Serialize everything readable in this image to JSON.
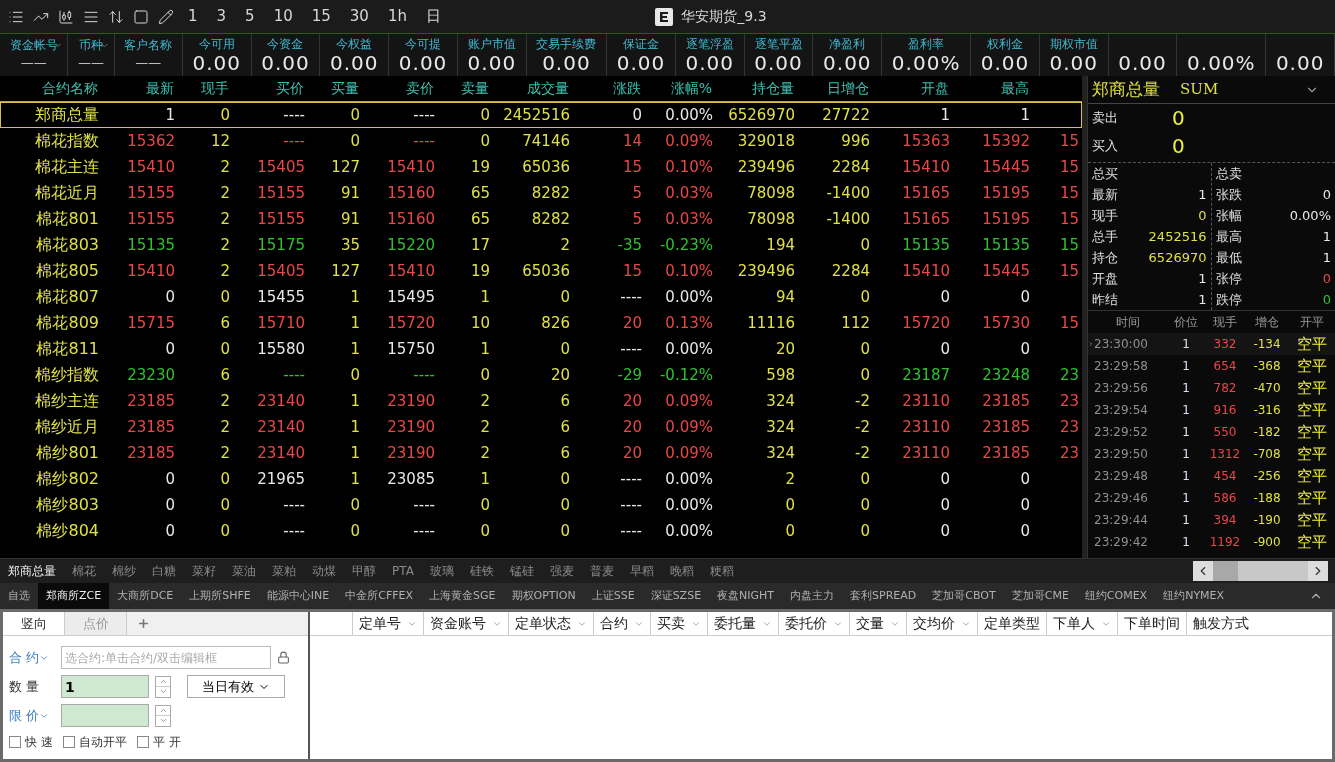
{
  "toolbar": {
    "periods": [
      "1",
      "3",
      "5",
      "10",
      "15",
      "30",
      "1h",
      "日"
    ],
    "title": "华安期货_9.3"
  },
  "account": [
    {
      "label": "资金帐号",
      "value": "——",
      "dropdown": true
    },
    {
      "label": "币种",
      "value": "——",
      "dropdown": true
    },
    {
      "label": "客户名称",
      "value": "——",
      "dropdown": false
    },
    {
      "label": "今可用",
      "value": "0.00",
      "dropdown": false
    },
    {
      "label": "今资金",
      "value": "0.00",
      "dropdown": false
    },
    {
      "label": "今权益",
      "value": "0.00",
      "dropdown": false
    },
    {
      "label": "今可提",
      "value": "0.00",
      "dropdown": false
    },
    {
      "label": "账户市值",
      "value": "0.00",
      "dropdown": false
    },
    {
      "label": "交易手续费",
      "value": "0.00",
      "dropdown": false
    },
    {
      "label": "保证金",
      "value": "0.00",
      "dropdown": false
    },
    {
      "label": "逐笔浮盈",
      "value": "0.00",
      "dropdown": false
    },
    {
      "label": "逐笔平盈",
      "value": "0.00",
      "dropdown": false
    },
    {
      "label": "净盈利",
      "value": "0.00",
      "dropdown": false
    },
    {
      "label": "盈利率",
      "value": "0.00%",
      "dropdown": false
    },
    {
      "label": "权利金",
      "value": "0.00",
      "dropdown": false
    },
    {
      "label": "期权市值",
      "value": "0.00",
      "dropdown": false
    },
    {
      "value": "0.00",
      "dropdown": false
    },
    {
      "value": "0.00%",
      "dropdown": false
    },
    {
      "value": "0.00",
      "dropdown": false
    }
  ],
  "quotes": {
    "name_header": "合约名称",
    "columns": [
      "最新",
      "现手",
      "买价",
      "买量",
      "卖价",
      "卖量",
      "成交量",
      "涨跌",
      "涨幅%",
      "持仓量",
      "日增仓",
      "开盘",
      "最高"
    ],
    "rows": [
      {
        "name": "郑商总量",
        "selected": true,
        "cells": [
          {
            "text": "1",
            "color": "#e8e8e8"
          },
          {
            "text": "0",
            "color": "#e0e048"
          },
          {
            "text": "----",
            "color": "#e8e8e8"
          },
          {
            "text": "0",
            "color": "#e0e048"
          },
          {
            "text": "----",
            "color": "#e8e8e8"
          },
          {
            "text": "0",
            "color": "#e0e048"
          },
          {
            "text": "2452516",
            "color": "#e0e048"
          },
          {
            "text": "0",
            "color": "#e8e8e8"
          },
          {
            "text": "0.00%",
            "color": "#e8e8e8"
          },
          {
            "text": "6526970",
            "color": "#e0e048"
          },
          {
            "text": "27722",
            "color": "#e0e048"
          },
          {
            "text": "1",
            "color": "#e8e8e8"
          },
          {
            "text": "1",
            "color": "#e8e8e8"
          }
        ]
      },
      {
        "name": "棉花指数",
        "selected": false,
        "cells": [
          {
            "text": "15362",
            "color": "#e84848"
          },
          {
            "text": "12",
            "color": "#e0e048"
          },
          {
            "text": "----",
            "color": "#e84848"
          },
          {
            "text": "0",
            "color": "#e0e048"
          },
          {
            "text": "----",
            "color": "#e84848"
          },
          {
            "text": "0",
            "color": "#e0e048"
          },
          {
            "text": "74146",
            "color": "#e0e048"
          },
          {
            "text": "14",
            "color": "#e84848"
          },
          {
            "text": "0.09%",
            "color": "#e84848"
          },
          {
            "text": "329018",
            "color": "#e0e048"
          },
          {
            "text": "996",
            "color": "#e0e048"
          },
          {
            "text": "15363",
            "color": "#e84848"
          },
          {
            "text": "15392",
            "color": "#e84848"
          },
          {
            "text": "15",
            "color": "#e84848"
          }
        ]
      },
      {
        "name": "棉花主连",
        "selected": false,
        "cells": [
          {
            "text": "15410",
            "color": "#e84848"
          },
          {
            "text": "2",
            "color": "#e0e048"
          },
          {
            "text": "15405",
            "color": "#e84848"
          },
          {
            "text": "127",
            "color": "#e0e048"
          },
          {
            "text": "15410",
            "color": "#e84848"
          },
          {
            "text": "19",
            "color": "#e0e048"
          },
          {
            "text": "65036",
            "color": "#e0e048"
          },
          {
            "text": "15",
            "color": "#e84848"
          },
          {
            "text": "0.10%",
            "color": "#e84848"
          },
          {
            "text": "239496",
            "color": "#e0e048"
          },
          {
            "text": "2284",
            "color": "#e0e048"
          },
          {
            "text": "15410",
            "color": "#e84848"
          },
          {
            "text": "15445",
            "color": "#e84848"
          },
          {
            "text": "15",
            "color": "#e84848"
          }
        ]
      },
      {
        "name": "棉花近月",
        "selected": false,
        "cells": [
          {
            "text": "15155",
            "color": "#e84848"
          },
          {
            "text": "2",
            "color": "#e0e048"
          },
          {
            "text": "15155",
            "color": "#e84848"
          },
          {
            "text": "91",
            "color": "#e0e048"
          },
          {
            "text": "15160",
            "color": "#e84848"
          },
          {
            "text": "65",
            "color": "#e0e048"
          },
          {
            "text": "8282",
            "color": "#e0e048"
          },
          {
            "text": "5",
            "color": "#e84848"
          },
          {
            "text": "0.03%",
            "color": "#e84848"
          },
          {
            "text": "78098",
            "color": "#e0e048"
          },
          {
            "text": "-1400",
            "color": "#e0e048"
          },
          {
            "text": "15165",
            "color": "#e84848"
          },
          {
            "text": "15195",
            "color": "#e84848"
          },
          {
            "text": "15",
            "color": "#e84848"
          }
        ]
      },
      {
        "name": "棉花801",
        "selected": false,
        "cells": [
          {
            "text": "15155",
            "color": "#e84848"
          },
          {
            "text": "2",
            "color": "#e0e048"
          },
          {
            "text": "15155",
            "color": "#e84848"
          },
          {
            "text": "91",
            "color": "#e0e048"
          },
          {
            "text": "15160",
            "color": "#e84848"
          },
          {
            "text": "65",
            "color": "#e0e048"
          },
          {
            "text": "8282",
            "color": "#e0e048"
          },
          {
            "text": "5",
            "color": "#e84848"
          },
          {
            "text": "0.03%",
            "color": "#e84848"
          },
          {
            "text": "78098",
            "color": "#e0e048"
          },
          {
            "text": "-1400",
            "color": "#e0e048"
          },
          {
            "text": "15165",
            "color": "#e84848"
          },
          {
            "text": "15195",
            "color": "#e84848"
          },
          {
            "text": "15",
            "color": "#e84848"
          }
        ]
      },
      {
        "name": "棉花803",
        "selected": false,
        "cells": [
          {
            "text": "15135",
            "color": "#30c030"
          },
          {
            "text": "2",
            "color": "#e0e048"
          },
          {
            "text": "15175",
            "color": "#30c030"
          },
          {
            "text": "35",
            "color": "#e0e048"
          },
          {
            "text": "15220",
            "color": "#30c030"
          },
          {
            "text": "17",
            "color": "#e0e048"
          },
          {
            "text": "2",
            "color": "#e0e048"
          },
          {
            "text": "-35",
            "color": "#30c030"
          },
          {
            "text": "-0.23%",
            "color": "#30c030"
          },
          {
            "text": "194",
            "color": "#e0e048"
          },
          {
            "text": "0",
            "color": "#e0e048"
          },
          {
            "text": "15135",
            "color": "#30c030"
          },
          {
            "text": "15135",
            "color": "#30c030"
          },
          {
            "text": "15",
            "color": "#30c030"
          }
        ]
      },
      {
        "name": "棉花805",
        "selected": false,
        "cells": [
          {
            "text": "15410",
            "color": "#e84848"
          },
          {
            "text": "2",
            "color": "#e0e048"
          },
          {
            "text": "15405",
            "color": "#e84848"
          },
          {
            "text": "127",
            "color": "#e0e048"
          },
          {
            "text": "15410",
            "color": "#e84848"
          },
          {
            "text": "19",
            "color": "#e0e048"
          },
          {
            "text": "65036",
            "color": "#e0e048"
          },
          {
            "text": "15",
            "color": "#e84848"
          },
          {
            "text": "0.10%",
            "color": "#e84848"
          },
          {
            "text": "239496",
            "color": "#e0e048"
          },
          {
            "text": "2284",
            "color": "#e0e048"
          },
          {
            "text": "15410",
            "color": "#e84848"
          },
          {
            "text": "15445",
            "color": "#e84848"
          },
          {
            "text": "15",
            "color": "#e84848"
          }
        ]
      },
      {
        "name": "棉花807",
        "selected": false,
        "cells": [
          {
            "text": "0",
            "color": "#e8e8e8"
          },
          {
            "text": "0",
            "color": "#e0e048"
          },
          {
            "text": "15455",
            "color": "#e8e8e8"
          },
          {
            "text": "1",
            "color": "#e0e048"
          },
          {
            "text": "15495",
            "color": "#e8e8e8"
          },
          {
            "text": "1",
            "color": "#e0e048"
          },
          {
            "text": "0",
            "color": "#e0e048"
          },
          {
            "text": "----",
            "color": "#e8e8e8"
          },
          {
            "text": "0.00%",
            "color": "#e8e8e8"
          },
          {
            "text": "94",
            "color": "#e0e048"
          },
          {
            "text": "0",
            "color": "#e0e048"
          },
          {
            "text": "0",
            "color": "#e8e8e8"
          },
          {
            "text": "0",
            "color": "#e8e8e8"
          }
        ]
      },
      {
        "name": "棉花809",
        "selected": false,
        "cells": [
          {
            "text": "15715",
            "color": "#e84848"
          },
          {
            "text": "6",
            "color": "#e0e048"
          },
          {
            "text": "15710",
            "color": "#e84848"
          },
          {
            "text": "1",
            "color": "#e0e048"
          },
          {
            "text": "15720",
            "color": "#e84848"
          },
          {
            "text": "10",
            "color": "#e0e048"
          },
          {
            "text": "826",
            "color": "#e0e048"
          },
          {
            "text": "20",
            "color": "#e84848"
          },
          {
            "text": "0.13%",
            "color": "#e84848"
          },
          {
            "text": "11116",
            "color": "#e0e048"
          },
          {
            "text": "112",
            "color": "#e0e048"
          },
          {
            "text": "15720",
            "color": "#e84848"
          },
          {
            "text": "15730",
            "color": "#e84848"
          },
          {
            "text": "15",
            "color": "#e84848"
          }
        ]
      },
      {
        "name": "棉花811",
        "selected": false,
        "cells": [
          {
            "text": "0",
            "color": "#e8e8e8"
          },
          {
            "text": "0",
            "color": "#e0e048"
          },
          {
            "text": "15580",
            "color": "#e8e8e8"
          },
          {
            "text": "1",
            "color": "#e0e048"
          },
          {
            "text": "15750",
            "color": "#e8e8e8"
          },
          {
            "text": "1",
            "color": "#e0e048"
          },
          {
            "text": "0",
            "color": "#e0e048"
          },
          {
            "text": "----",
            "color": "#e8e8e8"
          },
          {
            "text": "0.00%",
            "color": "#e8e8e8"
          },
          {
            "text": "20",
            "color": "#e0e048"
          },
          {
            "text": "0",
            "color": "#e0e048"
          },
          {
            "text": "0",
            "color": "#e8e8e8"
          },
          {
            "text": "0",
            "color": "#e8e8e8"
          }
        ]
      },
      {
        "name": "棉纱指数",
        "selected": false,
        "cells": [
          {
            "text": "23230",
            "color": "#30c030"
          },
          {
            "text": "6",
            "color": "#e0e048"
          },
          {
            "text": "----",
            "color": "#30c030"
          },
          {
            "text": "0",
            "color": "#e0e048"
          },
          {
            "text": "----",
            "color": "#30c030"
          },
          {
            "text": "0",
            "color": "#e0e048"
          },
          {
            "text": "20",
            "color": "#e0e048"
          },
          {
            "text": "-29",
            "color": "#30c030"
          },
          {
            "text": "-0.12%",
            "color": "#30c030"
          },
          {
            "text": "598",
            "color": "#e0e048"
          },
          {
            "text": "0",
            "color": "#e0e048"
          },
          {
            "text": "23187",
            "color": "#30c030"
          },
          {
            "text": "23248",
            "color": "#30c030"
          },
          {
            "text": "23",
            "color": "#30c030"
          }
        ]
      },
      {
        "name": "棉纱主连",
        "selected": false,
        "cells": [
          {
            "text": "23185",
            "color": "#e84848"
          },
          {
            "text": "2",
            "color": "#e0e048"
          },
          {
            "text": "23140",
            "color": "#e84848"
          },
          {
            "text": "1",
            "color": "#e0e048"
          },
          {
            "text": "23190",
            "color": "#e84848"
          },
          {
            "text": "2",
            "color": "#e0e048"
          },
          {
            "text": "6",
            "color": "#e0e048"
          },
          {
            "text": "20",
            "color": "#e84848"
          },
          {
            "text": "0.09%",
            "color": "#e84848"
          },
          {
            "text": "324",
            "color": "#e0e048"
          },
          {
            "text": "-2",
            "color": "#e0e048"
          },
          {
            "text": "23110",
            "color": "#e84848"
          },
          {
            "text": "23185",
            "color": "#e84848"
          },
          {
            "text": "23",
            "color": "#e84848"
          }
        ]
      },
      {
        "name": "棉纱近月",
        "selected": false,
        "cells": [
          {
            "text": "23185",
            "color": "#e84848"
          },
          {
            "text": "2",
            "color": "#e0e048"
          },
          {
            "text": "23140",
            "color": "#e84848"
          },
          {
            "text": "1",
            "color": "#e0e048"
          },
          {
            "text": "23190",
            "color": "#e84848"
          },
          {
            "text": "2",
            "color": "#e0e048"
          },
          {
            "text": "6",
            "color": "#e0e048"
          },
          {
            "text": "20",
            "color": "#e84848"
          },
          {
            "text": "0.09%",
            "color": "#e84848"
          },
          {
            "text": "324",
            "color": "#e0e048"
          },
          {
            "text": "-2",
            "color": "#e0e048"
          },
          {
            "text": "23110",
            "color": "#e84848"
          },
          {
            "text": "23185",
            "color": "#e84848"
          },
          {
            "text": "23",
            "color": "#e84848"
          }
        ]
      },
      {
        "name": "棉纱801",
        "selected": false,
        "cells": [
          {
            "text": "23185",
            "color": "#e84848"
          },
          {
            "text": "2",
            "color": "#e0e048"
          },
          {
            "text": "23140",
            "color": "#e84848"
          },
          {
            "text": "1",
            "color": "#e0e048"
          },
          {
            "text": "23190",
            "color": "#e84848"
          },
          {
            "text": "2",
            "color": "#e0e048"
          },
          {
            "text": "6",
            "color": "#e0e048"
          },
          {
            "text": "20",
            "color": "#e84848"
          },
          {
            "text": "0.09%",
            "color": "#e84848"
          },
          {
            "text": "324",
            "color": "#e0e048"
          },
          {
            "text": "-2",
            "color": "#e0e048"
          },
          {
            "text": "23110",
            "color": "#e84848"
          },
          {
            "text": "23185",
            "color": "#e84848"
          },
          {
            "text": "23",
            "color": "#e84848"
          }
        ]
      },
      {
        "name": "棉纱802",
        "selected": false,
        "cells": [
          {
            "text": "0",
            "color": "#e8e8e8"
          },
          {
            "text": "0",
            "color": "#e0e048"
          },
          {
            "text": "21965",
            "color": "#e8e8e8"
          },
          {
            "text": "1",
            "color": "#e0e048"
          },
          {
            "text": "23085",
            "color": "#e8e8e8"
          },
          {
            "text": "1",
            "color": "#e0e048"
          },
          {
            "text": "0",
            "color": "#e0e048"
          },
          {
            "text": "----",
            "color": "#e8e8e8"
          },
          {
            "text": "0.00%",
            "color": "#e8e8e8"
          },
          {
            "text": "2",
            "color": "#e0e048"
          },
          {
            "text": "0",
            "color": "#e0e048"
          },
          {
            "text": "0",
            "color": "#e8e8e8"
          },
          {
            "text": "0",
            "color": "#e8e8e8"
          }
        ]
      },
      {
        "name": "棉纱803",
        "selected": false,
        "cells": [
          {
            "text": "0",
            "color": "#e8e8e8"
          },
          {
            "text": "0",
            "color": "#e0e048"
          },
          {
            "text": "----",
            "color": "#e8e8e8"
          },
          {
            "text": "0",
            "color": "#e0e048"
          },
          {
            "text": "----",
            "color": "#e8e8e8"
          },
          {
            "text": "0",
            "color": "#e0e048"
          },
          {
            "text": "0",
            "color": "#e0e048"
          },
          {
            "text": "----",
            "color": "#e8e8e8"
          },
          {
            "text": "0.00%",
            "color": "#e8e8e8"
          },
          {
            "text": "0",
            "color": "#e0e048"
          },
          {
            "text": "0",
            "color": "#e0e048"
          },
          {
            "text": "0",
            "color": "#e8e8e8"
          },
          {
            "text": "0",
            "color": "#e8e8e8"
          }
        ]
      },
      {
        "name": "棉纱804",
        "selected": false,
        "cells": [
          {
            "text": "0",
            "color": "#e8e8e8"
          },
          {
            "text": "0",
            "color": "#e0e048"
          },
          {
            "text": "----",
            "color": "#e8e8e8"
          },
          {
            "text": "0",
            "color": "#e0e048"
          },
          {
            "text": "----",
            "color": "#e8e8e8"
          },
          {
            "text": "0",
            "color": "#e0e048"
          },
          {
            "text": "0",
            "color": "#e0e048"
          },
          {
            "text": "----",
            "color": "#e8e8e8"
          },
          {
            "text": "0.00%",
            "color": "#e8e8e8"
          },
          {
            "text": "0",
            "color": "#e0e048"
          },
          {
            "text": "0",
            "color": "#e0e048"
          },
          {
            "text": "0",
            "color": "#e8e8e8"
          },
          {
            "text": "0",
            "color": "#e8e8e8"
          }
        ]
      }
    ]
  },
  "detail": {
    "title": "郑商总量",
    "code": "SUM",
    "orders": [
      {
        "label": "卖出",
        "value": "0"
      },
      {
        "label": "买入",
        "value": "0"
      }
    ],
    "left": [
      {
        "label": "总买"
      },
      {
        "label": "最新",
        "value": "1",
        "color": "#e8e8e8"
      },
      {
        "label": "现手",
        "value": "0",
        "color": "#e0e048"
      },
      {
        "label": "总手",
        "value": "2452516",
        "color": "#e0e048"
      },
      {
        "label": "持仓",
        "value": "6526970",
        "color": "#e0e048"
      },
      {
        "label": "开盘",
        "value": "1",
        "color": "#e8e8e8"
      },
      {
        "label": "昨结",
        "value": "1",
        "color": "#e8e8e8"
      }
    ],
    "right": [
      {
        "label": "总卖"
      },
      {
        "label": "张跌",
        "value": "0",
        "color": "#e8e8e8"
      },
      {
        "label": "张幅",
        "value": "0.00%",
        "color": "#e8e8e8"
      },
      {
        "label": "最高",
        "value": "1",
        "color": "#e8e8e8"
      },
      {
        "label": "最低",
        "value": "1",
        "color": "#e8e8e8"
      },
      {
        "label": "张停",
        "value": "0",
        "color": "#e84848"
      },
      {
        "label": "跌停",
        "value": "0",
        "color": "#30c030"
      }
    ],
    "tick_columns": [
      "时间",
      "价位",
      "现手",
      "增仓",
      "开平"
    ],
    "ticks": [
      {
        "time": "23:30:00",
        "price": "1",
        "volume": "332",
        "change": "-134",
        "type": "空平",
        "selected": true
      },
      {
        "time": "23:29:58",
        "price": "1",
        "volume": "654",
        "change": "-368",
        "type": "空平",
        "selected": false
      },
      {
        "time": "23:29:56",
        "price": "1",
        "volume": "782",
        "change": "-470",
        "type": "空平",
        "selected": false
      },
      {
        "time": "23:29:54",
        "price": "1",
        "volume": "916",
        "change": "-316",
        "type": "空平",
        "selected": false
      },
      {
        "time": "23:29:52",
        "price": "1",
        "volume": "550",
        "change": "-182",
        "type": "空平",
        "selected": false
      },
      {
        "time": "23:29:50",
        "price": "1",
        "volume": "1312",
        "change": "-708",
        "type": "空平",
        "selected": false
      },
      {
        "time": "23:29:48",
        "price": "1",
        "volume": "454",
        "change": "-256",
        "type": "空平",
        "selected": false
      },
      {
        "time": "23:29:46",
        "price": "1",
        "volume": "586",
        "change": "-188",
        "type": "空平",
        "selected": false
      },
      {
        "time": "23:29:44",
        "price": "1",
        "volume": "394",
        "change": "-190",
        "type": "空平",
        "selected": false
      },
      {
        "time": "23:29:42",
        "price": "1",
        "volume": "1192",
        "change": "-900",
        "type": "空平",
        "selected": false
      }
    ]
  },
  "category_tabs": [
    {
      "label": "郑商总量",
      "selected": true
    },
    {
      "label": "棉花",
      "selected": false
    },
    {
      "label": "棉纱",
      "selected": false
    },
    {
      "label": "白糖",
      "selected": false
    },
    {
      "label": "菜籽",
      "selected": false
    },
    {
      "label": "菜油",
      "selected": false
    },
    {
      "label": "菜粕",
      "selected": false
    },
    {
      "label": "动煤",
      "selected": false
    },
    {
      "label": "甲醇",
      "selected": false
    },
    {
      "label": "PTA",
      "selected": false
    },
    {
      "label": "玻璃",
      "selected": false
    },
    {
      "label": "硅铁",
      "selected": false
    },
    {
      "label": "锰硅",
      "selected": false
    },
    {
      "label": "强麦",
      "selected": false
    },
    {
      "label": "普麦",
      "selected": false
    },
    {
      "label": "早稻",
      "selected": false
    },
    {
      "label": "晚稻",
      "selected": false
    },
    {
      "label": "粳稻",
      "selected": false
    }
  ],
  "exchange_tabs": [
    {
      "label": "自选",
      "selected": false
    },
    {
      "label": "郑商所ZCE",
      "selected": true
    },
    {
      "label": "大商所DCE",
      "selected": false
    },
    {
      "label": "上期所SHFE",
      "selected": false
    },
    {
      "label": "能源中心INE",
      "selected": false
    },
    {
      "label": "中金所CFFEX",
      "selected": false
    },
    {
      "label": "上海黄金SGE",
      "selected": false
    },
    {
      "label": "期权OPTION",
      "selected": false
    },
    {
      "label": "上证SSE",
      "selected": false
    },
    {
      "label": "深证SZSE",
      "selected": false
    },
    {
      "label": "夜盘NIGHT",
      "selected": false
    },
    {
      "label": "内盘主力",
      "selected": false
    },
    {
      "label": "套利SPREAD",
      "selected": false
    },
    {
      "label": "芝加哥CBOT",
      "selected": false
    },
    {
      "label": "芝加哥CME",
      "selected": false
    },
    {
      "label": "纽约COMEX",
      "selected": false
    },
    {
      "label": "纽约NYMEX",
      "selected": false
    }
  ],
  "order_panel": {
    "tabs": [
      {
        "label": "竖向",
        "selected": true
      },
      {
        "label": "点价",
        "selected": false
      }
    ],
    "contract": {
      "label": "合 约",
      "placeholder": "选合约:单击合约/双击编辑框"
    },
    "quantity": {
      "label": "数 量",
      "value": "1",
      "validity": "当日有效"
    },
    "price": {
      "label": "限 价"
    },
    "options": [
      {
        "label": "快 速",
        "checked": false
      },
      {
        "label": "自动开平",
        "checked": false
      },
      {
        "label": "平 开",
        "checked": false
      }
    ]
  },
  "orders_table": {
    "columns": [
      {
        "label": "定单号",
        "filter": true
      },
      {
        "label": "资金账号",
        "filter": true
      },
      {
        "label": "定单状态",
        "filter": true
      },
      {
        "label": "合约",
        "filter": true
      },
      {
        "label": "买卖",
        "filter": true
      },
      {
        "label": "委托量",
        "filter": true
      },
      {
        "label": "委托价",
        "filter": true
      },
      {
        "label": "交量",
        "filter": true
      },
      {
        "label": "交均价",
        "filter": true
      },
      {
        "label": "定单类型",
        "filter": false
      },
      {
        "label": "下单人",
        "filter": true
      },
      {
        "label": "下单时间",
        "filter": false
      },
      {
        "label": "触发方式",
        "filter": false
      }
    ]
  }
}
